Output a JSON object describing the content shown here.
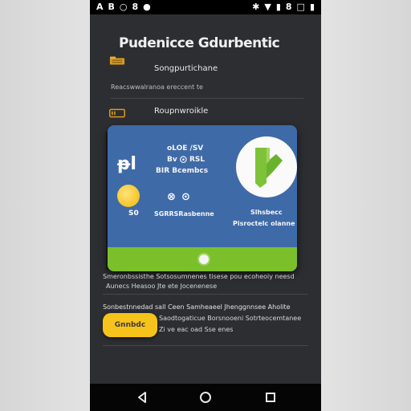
{
  "status_bar": {
    "left_glyphs": [
      "A",
      "B",
      "○",
      "8",
      "●"
    ],
    "right_glyphs": [
      "✱",
      "▼",
      "▮",
      "8",
      "□",
      "▮"
    ]
  },
  "header": {
    "title": "Pudenicce Gdurbentic"
  },
  "rows": [
    {
      "label": "Songpurtichane",
      "icon": "folder-icon"
    },
    {
      "label": "Roupnwroikle",
      "icon": "wallet-icon"
    }
  ],
  "row_sub": "Reacswwalranoa ereccent te",
  "card": {
    "logo": "ᵽl",
    "line1": "oLOE /SV",
    "line2": "Bv  ⨀  RSL",
    "line3": "BIR Bcembcs",
    "coin_label": "S0",
    "pair_icons": [
      "⊗",
      "⊙"
    ],
    "amount_text": "SGRRSRasbenne",
    "right_label_1": "Slhsbecc",
    "right_label_2": "Pisroctelc  olanne",
    "brand_colors": {
      "primary": "#3f6aa8",
      "accent": "#7bbf2a",
      "mark": "#7ec23a"
    }
  },
  "paragraph_1": [
    "Smeronbssisthe Sotsosumnenes tisese pou ecoheoiy neesd",
    "Aunecs Heasoo Jte ete Jocenenese"
  ],
  "paragraph_2": [
    "Sonbestnnedad sall Ceen Samheaeel Jhenggnnsee Aholite",
    "Saodtogaticue Borsnooeni Sotrteocemtanee"
  ],
  "action_button": {
    "label": "Gnnbdc",
    "color": "#f6c31a"
  },
  "button_side_text": "Zi ve eac oad Sse enes",
  "nav": {
    "back": "back-icon",
    "home": "home-icon",
    "recents": "recents-icon"
  }
}
